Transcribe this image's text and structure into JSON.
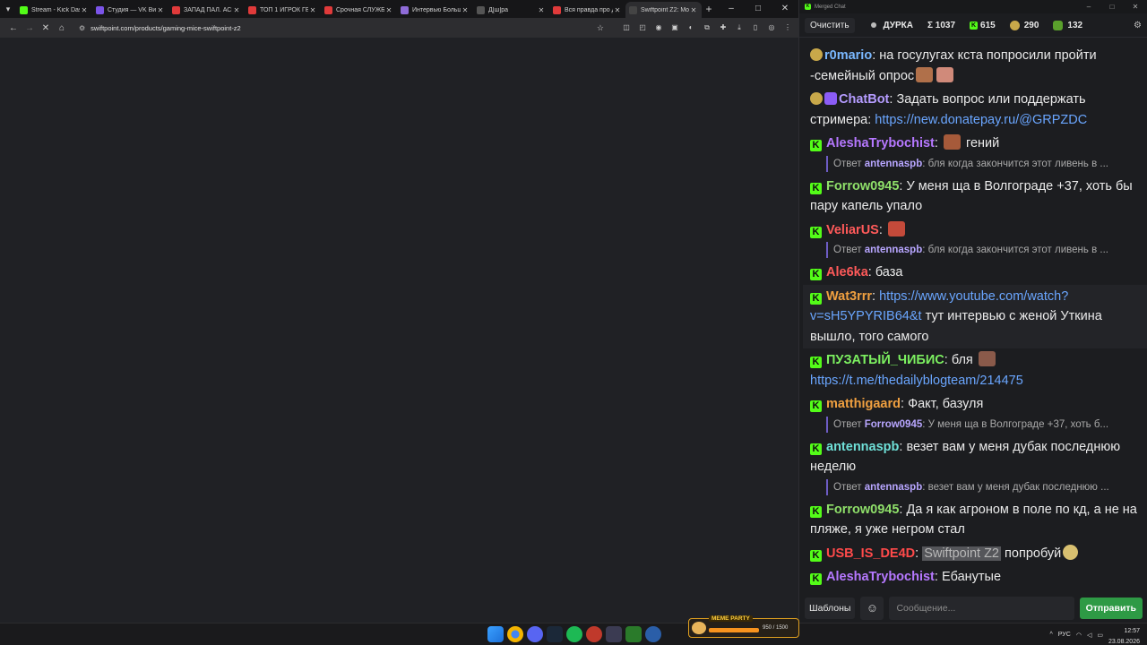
{
  "browser": {
    "tabs": [
      {
        "title": "Stream - Kick Das",
        "color": "#53fc18"
      },
      {
        "title": "Студия — VK Вид",
        "color": "#7b54e8"
      },
      {
        "title": "ЗАПАД ПАЛ. АСИ",
        "color": "#e03a3a"
      },
      {
        "title": "ТОП 1 ИГРОК ГЕ",
        "color": "#e03a3a"
      },
      {
        "title": "Срочная СЛУЖБА",
        "color": "#e03a3a"
      },
      {
        "title": "Интервью Больш",
        "color": "#8e6bd8"
      },
      {
        "title": "Д[ш]ра",
        "color": "#555555"
      },
      {
        "title": "Вся правда про Д",
        "color": "#e03a3a"
      },
      {
        "title": "Swiftpoint Z2: Mo",
        "color": "#444444"
      }
    ],
    "active_tab": 8,
    "url": "swiftpoint.com/products/gaming-mice-swiftpoint-z2"
  },
  "chat": {
    "window_title": "Merged Chat",
    "clear_label": "Очистить",
    "channel": "ДУРКА",
    "total_label": "Σ 1037",
    "kick_count": "615",
    "other_count": "290",
    "third_count": "132",
    "messages": [
      {
        "type": "msg",
        "badge": "yt",
        "user": "r0mario",
        "color": "#7ab8ff",
        "text": "на госулугах кста попросили пройти -семейный опрос",
        "emotes": 2
      },
      {
        "type": "msg",
        "badge": "yt",
        "user": "ChatBot",
        "color": "#b59cff",
        "text": "Задать вопрос или поддержать стримера:",
        "link": "https://new.donatepay.ru/@GRPZDC"
      },
      {
        "type": "msg",
        "badge": "kick",
        "user": "AleshaTrybochist",
        "color": "#b678ff",
        "text": "гений",
        "emote_before": true
      },
      {
        "type": "reply",
        "user": "antennaspb",
        "text": "бля когда закончится этот ливень в ..."
      },
      {
        "type": "msg",
        "badge": "kick",
        "user": "Forrow0945",
        "color": "#8fe06a",
        "text": "У меня ща в Волгограде +37, хоть бы пару капель упало"
      },
      {
        "type": "msg",
        "badge": "kick",
        "user": "VeliarUS",
        "color": "#ff5a5a",
        "text": "",
        "emote_before": true
      },
      {
        "type": "reply",
        "user": "antennaspb",
        "text": "бля когда закончится этот ливень в ..."
      },
      {
        "type": "msg",
        "badge": "kick",
        "user": "Ale6ka",
        "color": "#ff5a5a",
        "text": "база"
      },
      {
        "type": "msg",
        "badge": "kick",
        "user": "Wat3rrr",
        "color": "#f0a040",
        "link": "https://www.youtube.com/watch?v=sH5YPYRIB64&t",
        "after": "тут интервью с женой Уткина вышло, того самого",
        "hl": true
      },
      {
        "type": "msg",
        "badge": "kick",
        "user": "ПУЗАТЫЙ_ЧИБИС",
        "color": "#7cf060",
        "text": "бля",
        "emote_after": true,
        "link2": "https://t.me/thedailyblogteam/214475"
      },
      {
        "type": "msg",
        "badge": "kick",
        "user": "matthigaard",
        "color": "#f0a040",
        "text": "Факт, базуля"
      },
      {
        "type": "reply",
        "user": "Forrow0945",
        "text": "У меня ща в Волгограде +37, хоть б..."
      },
      {
        "type": "msg",
        "badge": "kick",
        "user": "antennaspb",
        "color": "#6fe0d8",
        "text": "везет вам у меня дубак последнюю неделю"
      },
      {
        "type": "reply",
        "user": "antennaspb",
        "text": "везет вам у меня дубак последнюю ..."
      },
      {
        "type": "msg",
        "badge": "kick",
        "user": "Forrow0945",
        "color": "#8fe06a",
        "text": "Да я как агроном в поле по кд, а не на пляже, я уже негром стал"
      },
      {
        "type": "msg",
        "badge": "kick",
        "user": "USB_IS_DE4D",
        "color": "#ff4a4a",
        "mention": "Swiftpoint Z2",
        "text": "попробуй"
      },
      {
        "type": "msg",
        "badge": "kick",
        "user": "AleshaTrybochist",
        "color": "#b678ff",
        "text": "Ебанутые"
      }
    ],
    "reply_prefix": "Ответ",
    "templates_label": "Шаблоны",
    "input_placeholder": "Сообщение...",
    "send_label": "Отправить"
  },
  "taskbar": {
    "widget_title": "MEME PARTY",
    "widget_value": "950 / 1500",
    "lang": "РУС",
    "time": "12:57",
    "date": "23.08.2026"
  }
}
